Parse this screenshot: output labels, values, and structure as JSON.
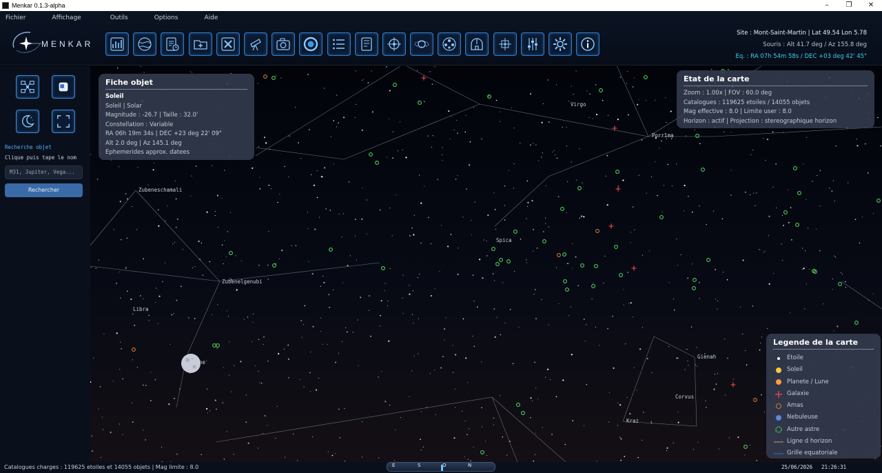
{
  "window": {
    "title": "Menkar 0.1.3-alpha",
    "minimize": "–",
    "maximize": "❐",
    "close": "✕"
  },
  "menu": [
    "Fichier",
    "Affichage",
    "Outils",
    "Options",
    "Aide"
  ],
  "logo": {
    "text": "MENKAR"
  },
  "toolbar": {
    "buttons": [
      "chart-icon",
      "globe-icon",
      "checklist-clock-icon",
      "folder-add-icon",
      "tools-icon",
      "telescope-icon",
      "camera-icon",
      "eye-ring-icon",
      "list-icon",
      "document-icon",
      "crosshair-icon",
      "planet-rings-icon",
      "color-wheel-icon",
      "observatory-icon",
      "grid-target-icon",
      "sliders-icon",
      "gear-icon",
      "info-icon"
    ]
  },
  "site": {
    "line1": "Site : Mont-Saint-Martin  |  Lat 49.54  Lon 5.78",
    "line2": "Souris : Alt 41.7 deg / Az 155.8 deg",
    "line3": "Eq. : RA 07h 54m 58s / DEC +03 deg 42' 45\""
  },
  "left_panel": {
    "buttons": [
      "constellation-network-icon",
      "window-icon",
      "moon-night-icon",
      "fullscreen-icon"
    ],
    "search_title": "Recherche objet",
    "search_hint": "Clique puis tape le nom",
    "search_placeholder": "M31, Jupiter, Vega...",
    "search_button": "Rechercher"
  },
  "fiche": {
    "title": "Fiche objet",
    "name": "Soleil",
    "type": "Soleil  |  Solar",
    "magnitude": "Magnitude : -26.7  |  Taille : 32.0'",
    "constellation": "Constellation : Variable",
    "coords": "RA 06h 19m 34s  |  DEC +23 deg 22' 09\"",
    "altaz": "Alt 2.0 deg  |  Az 145.1 deg",
    "note": "Ephemerides approx. datees"
  },
  "etat": {
    "title": "Etat de la carte",
    "zoom": "Zoom : 1.00x  |  FOV : 60.0 deg",
    "catalogues": "Catalogues : 119625 etoiles / 14055 objets",
    "mag": "Mag effective : 8.0  |  Limite user : 8.0",
    "horizon": "Horizon : actif  |  Projection : stereographique horizon"
  },
  "legende": {
    "title": "Legende de la carte",
    "items": [
      "Etoile",
      "Soleil",
      "Planete / Lune",
      "Galaxie",
      "Amas",
      "Nebuleuse",
      "Autre astre",
      "Ligne d horizon",
      "Grille equatoriale"
    ],
    "colors": {
      "etoile": "#ffffff",
      "soleil": "#ffc83c",
      "planete": "#ff9a46",
      "galaxie": "#ff4a4a",
      "amas": "#d07a3a",
      "nebuleuse": "#5a8ae0",
      "autre": "#4ad25a",
      "horizon": "#c8a070",
      "grille": "#3a6ad0"
    }
  },
  "sky_labels": {
    "virgo": "Virgo",
    "porrima": "Porrima",
    "zubeneschamali": "Zubeneschamali",
    "spica": "Spica",
    "zubenelgenubi": "Zubenelgenubi",
    "libra": "Libra",
    "lune": "Lune",
    "gienah": "Gienah",
    "corvus": "Corvus",
    "kraz": "Kraz"
  },
  "status": {
    "text": "Catalogues charges : 119625 etoiles et 14055 objets  |  Mag limite : 8.0",
    "compass": [
      "E",
      "S",
      "O",
      "N"
    ],
    "date": "25/06/2026",
    "time": "21:26:31"
  }
}
